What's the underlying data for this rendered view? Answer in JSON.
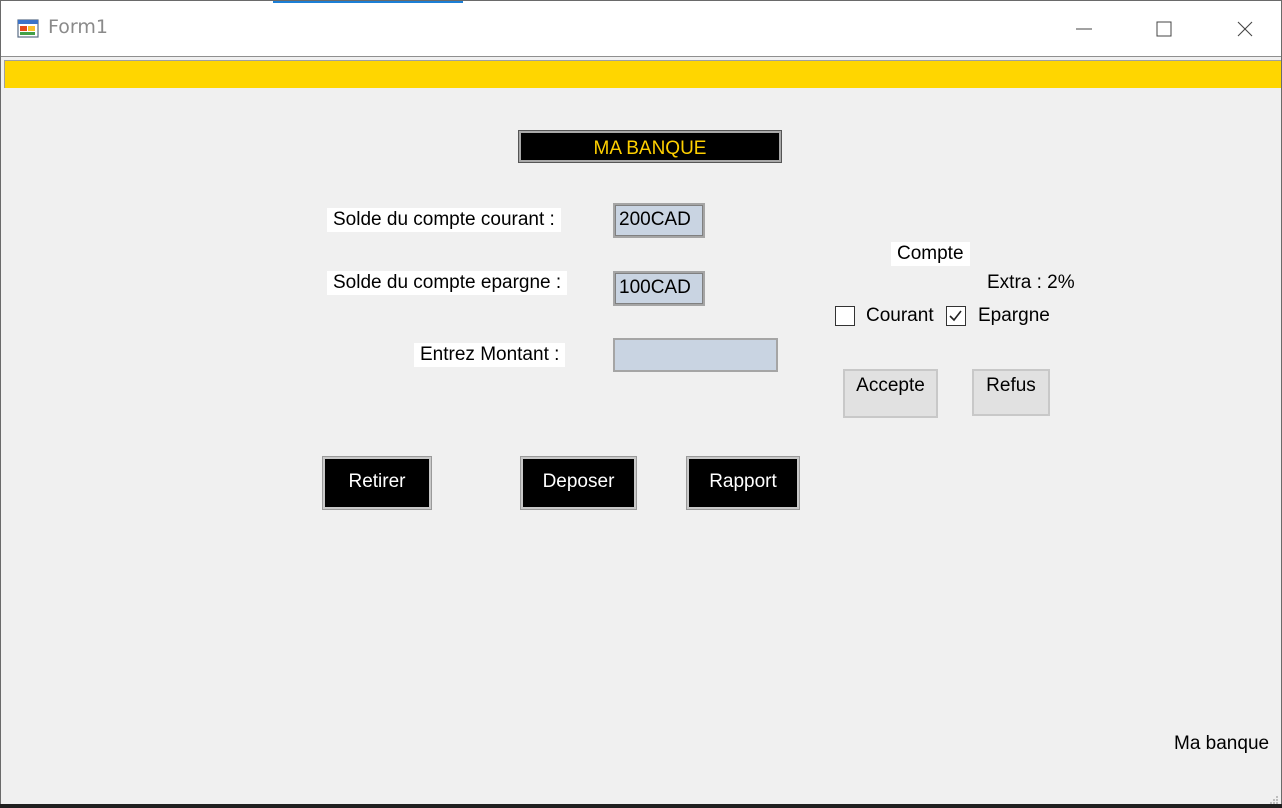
{
  "window": {
    "title": "Form1",
    "controls": {
      "minimize": "minimize-icon",
      "maximize": "maximize-icon",
      "close": "close-icon"
    }
  },
  "colors": {
    "accent_yellow": "#ffd600",
    "header_text": "#ffd000",
    "value_box": "#c9d4e2"
  },
  "form": {
    "header": "MA BANQUE",
    "fields": [
      {
        "label": "Solde du compte courant :",
        "value": "200CAD"
      },
      {
        "label": "Solde du compte epargne :",
        "value": "100CAD"
      }
    ],
    "amount": {
      "label": "Entrez Montant :",
      "value": ""
    },
    "account_panel": {
      "title": "Compte",
      "extra": "Extra : 2%",
      "options": [
        {
          "label": "Courant",
          "checked": false
        },
        {
          "label": "Epargne",
          "checked": true
        }
      ],
      "accept_label": "Accepte",
      "refuse_label": "Refus"
    },
    "actions": {
      "withdraw": "Retirer",
      "deposit": "Deposer",
      "report": "Rapport"
    },
    "footer": "Ma banque"
  }
}
